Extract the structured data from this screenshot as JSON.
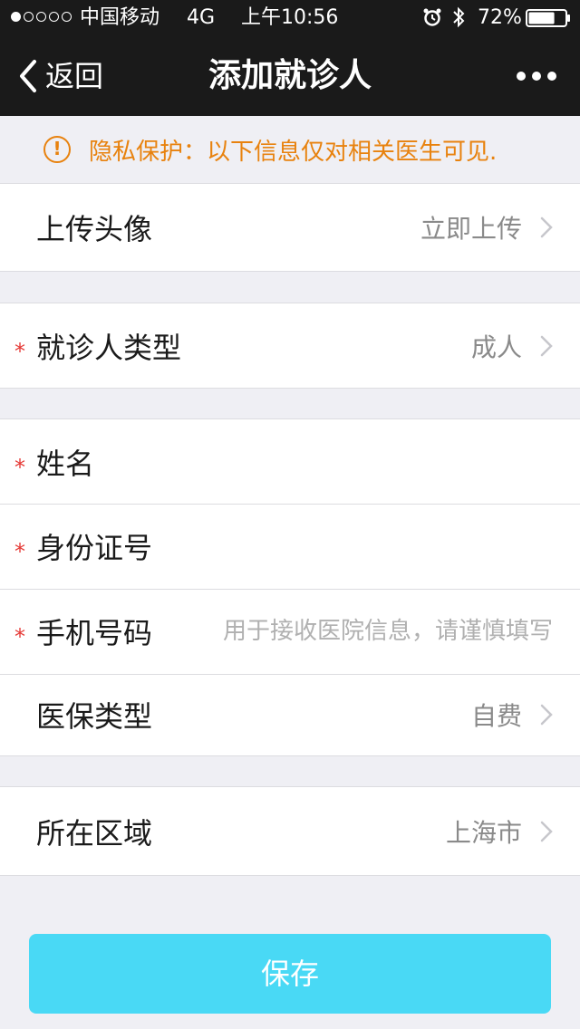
{
  "status_bar": {
    "carrier": "中国移动",
    "network": "4G",
    "time": "上午10:56",
    "battery": "72%",
    "battery_level": 0.72,
    "icons": [
      "alarm-icon",
      "bluetooth-icon",
      "battery-icon"
    ]
  },
  "nav": {
    "back_label": "返回",
    "title": "添加就诊人",
    "more_icon": "more-icon"
  },
  "privacy": {
    "icon": "warning-icon",
    "text": "隐私保护：以下信息仅对相关医生可见."
  },
  "rows": {
    "avatar": {
      "label": "上传头像",
      "value": "立即上传"
    },
    "patient_type": {
      "label": "就诊人类型",
      "value": "成人",
      "required": "*"
    },
    "name": {
      "label": "姓名",
      "required": "*"
    },
    "id_number": {
      "label": "身份证号",
      "required": "*"
    },
    "phone": {
      "label": "手机号码",
      "placeholder": "用于接收医院信息，请谨慎填写",
      "required": "*"
    },
    "insurance": {
      "label": "医保类型",
      "value": "自费"
    },
    "region": {
      "label": "所在区域",
      "value": "上海市"
    }
  },
  "save_label": "保存",
  "colors": {
    "nav_bg": "#1a1a1a",
    "warning": "#e8820e",
    "required": "#e53935",
    "primary": "#49d9f5",
    "page_bg": "#efeff4"
  }
}
